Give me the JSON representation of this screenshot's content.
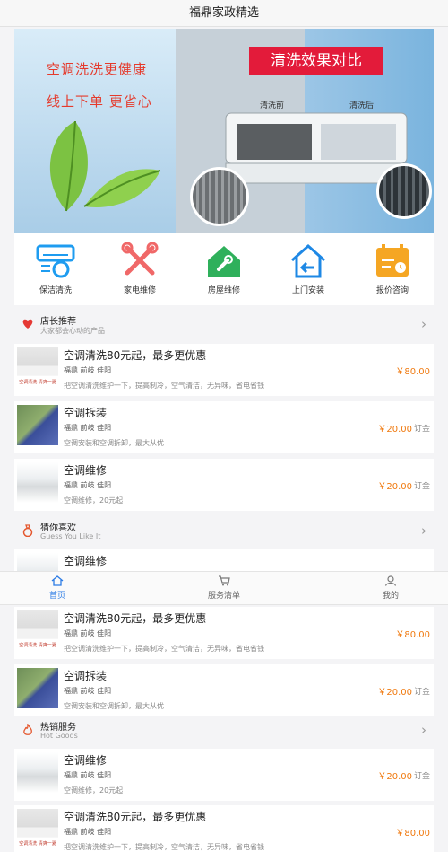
{
  "header": {
    "title": "福鼎家政精选"
  },
  "banner": {
    "slogan_line1": "空调洗洗更健康",
    "slogan_line2": "线上下单 更省心",
    "compare_title": "清洗效果对比",
    "before_label": "清洗前",
    "after_label": "清洗后"
  },
  "quicknav": [
    {
      "label": "保洁清洗",
      "icon": "ac-cleaning-icon",
      "color": "#1e9cf0"
    },
    {
      "label": "家电维修",
      "icon": "tools-icon",
      "color": "#f06868"
    },
    {
      "label": "房屋维修",
      "icon": "house-wrench-icon",
      "color": "#2fb05b"
    },
    {
      "label": "上门安装",
      "icon": "home-return-icon",
      "color": "#1e88e5"
    },
    {
      "label": "报价咨询",
      "icon": "calendar-icon",
      "color": "#f5a623"
    }
  ],
  "sections": {
    "recommend": {
      "title": "店长推荐",
      "subtitle": "大家都会心动的产品"
    },
    "guess": {
      "title": "猜你喜欢",
      "subtitle": "Guess You Like It"
    },
    "hot": {
      "title": "热销服务",
      "subtitle": "Hot Goods"
    }
  },
  "products": {
    "clean": {
      "title": "空调清洗80元起，最多更优惠",
      "location": "福鼎 前岐 佳阳",
      "desc": "把空调清洗维护一下，提高制冷，空气清洁，无异味，省电省钱",
      "price": "￥80.00",
      "thumb_text": "空调清洗 清爽一夏"
    },
    "dismantle": {
      "title": "空调拆装",
      "location": "福鼎 前岐 佳阳",
      "desc": "空调安装和空调拆卸，最大从优",
      "price": "￥20.00",
      "order": "订金"
    },
    "repair": {
      "title": "空调维修",
      "location": "福鼎 前岐 佳阳",
      "desc": "空调维修，20元起",
      "price": "￥20.00",
      "order": "订金"
    },
    "guess_peek": {
      "title": "空调维修"
    }
  },
  "tabbar": [
    {
      "label": "首页",
      "icon": "home-icon",
      "active": true
    },
    {
      "label": "服务清单",
      "icon": "cart-icon",
      "active": false
    },
    {
      "label": "我的",
      "icon": "user-icon",
      "active": false
    }
  ]
}
